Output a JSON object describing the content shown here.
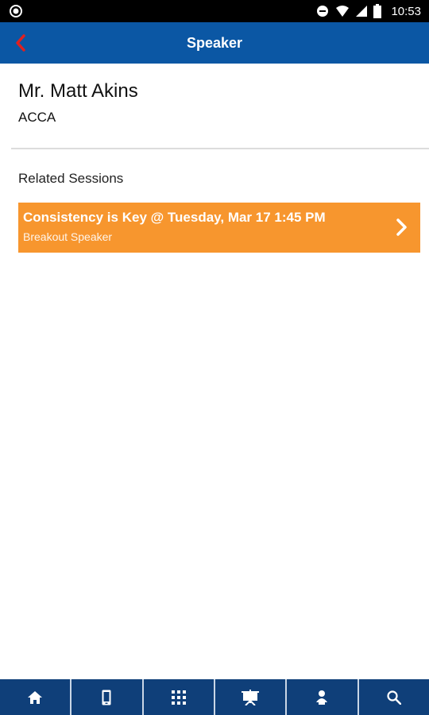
{
  "status_bar": {
    "time": "10:53",
    "icons": [
      "record-icon",
      "do-not-disturb-icon",
      "wifi-icon",
      "signal-icon",
      "battery-icon"
    ]
  },
  "app_bar": {
    "title": "Speaker",
    "back_icon": "chevron-left-icon",
    "colors": {
      "background": "#0b57a4",
      "back_icon": "#e02020"
    }
  },
  "speaker": {
    "name": "Mr. Matt Akins",
    "organization": "ACCA"
  },
  "related_sessions": {
    "title": "Related Sessions",
    "items": [
      {
        "title": "Consistency is Key @ Tuesday, Mar 17 1:45 PM",
        "subtitle": "Breakout Speaker",
        "icon": "chevron-right-icon",
        "color": "#f7962e"
      }
    ]
  },
  "bottom_nav": {
    "background": "#0f3f79",
    "items": [
      {
        "icon": "home-icon"
      },
      {
        "icon": "mobile-icon"
      },
      {
        "icon": "grid-icon"
      },
      {
        "icon": "presentation-icon"
      },
      {
        "icon": "speaker-icon"
      },
      {
        "icon": "search-icon"
      }
    ]
  }
}
